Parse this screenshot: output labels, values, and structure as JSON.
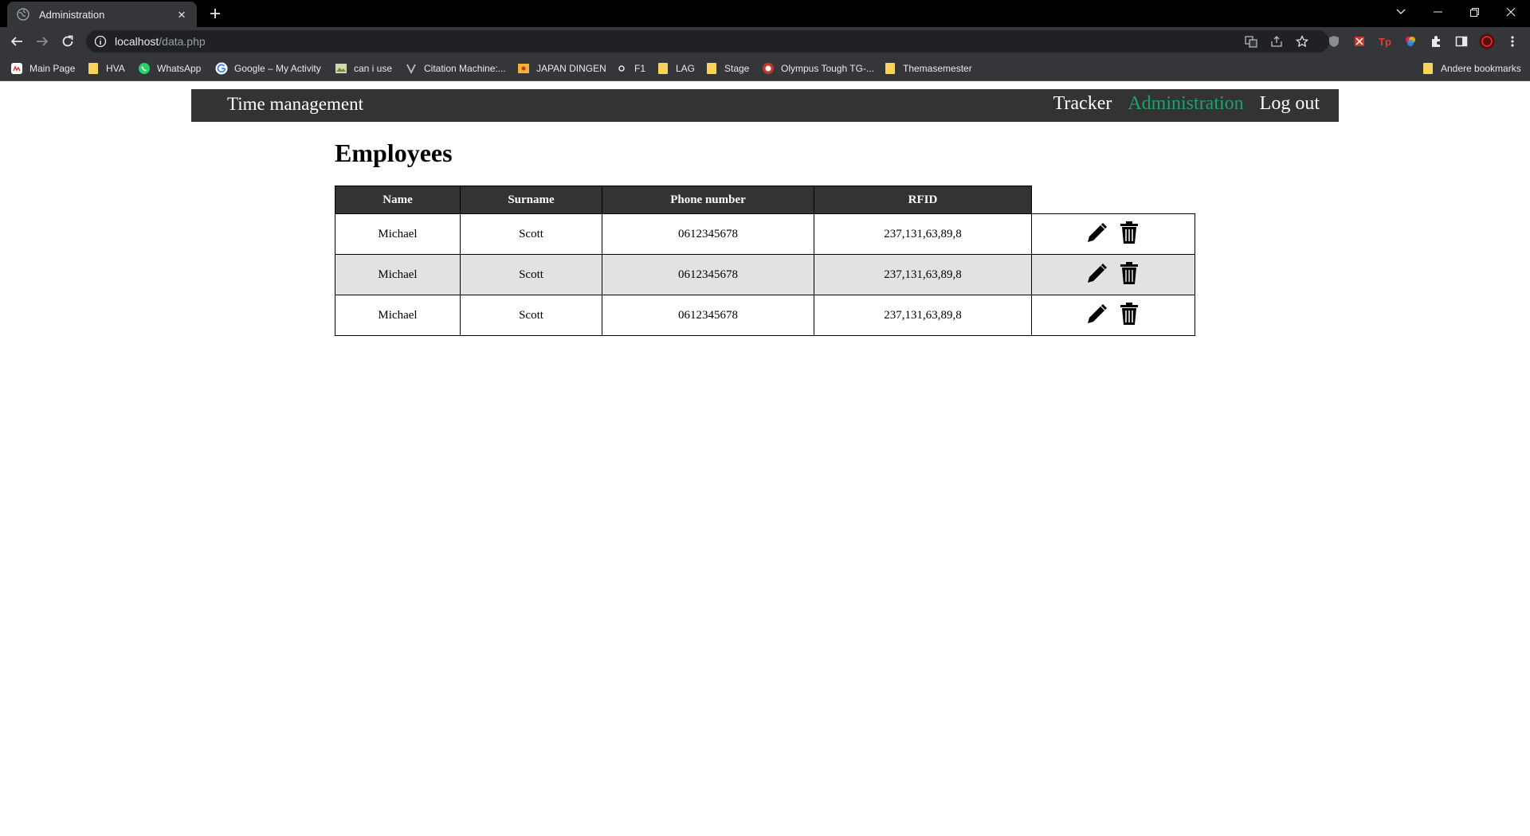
{
  "browser": {
    "tab_title": "Administration",
    "url_host": "localhost",
    "url_path": "/data.php",
    "bookmarks": [
      {
        "label": "Main Page",
        "icon": "app-icon"
      },
      {
        "label": "HVA",
        "icon": "folder-icon"
      },
      {
        "label": "WhatsApp",
        "icon": "whatsapp-icon"
      },
      {
        "label": "Google – My Activity",
        "icon": "google-icon"
      },
      {
        "label": "can i use",
        "icon": "caniuse-icon"
      },
      {
        "label": "Citation Machine:...",
        "icon": "citation-icon"
      },
      {
        "label": "JAPAN DINGEN",
        "icon": "folder-icon"
      },
      {
        "label": "F1",
        "icon": "f1-icon"
      },
      {
        "label": "LAG",
        "icon": "folder-icon"
      },
      {
        "label": "Stage",
        "icon": "folder-icon"
      },
      {
        "label": "Olympus Tough TG-...",
        "icon": "olympus-icon"
      },
      {
        "label": "Themasemester",
        "icon": "folder-icon"
      }
    ],
    "other_bookmarks": "Andere bookmarks"
  },
  "nav": {
    "brand": "Time management",
    "links": [
      {
        "label": "Tracker",
        "active": false
      },
      {
        "label": "Administration",
        "active": true
      },
      {
        "label": "Log out",
        "active": false
      }
    ],
    "active_color": "#1aa36b"
  },
  "page": {
    "title": "Employees"
  },
  "table": {
    "headers": [
      "Name",
      "Surname",
      "Phone number",
      "RFID"
    ],
    "rows": [
      {
        "name": "Michael",
        "surname": "Scott",
        "phone": "0612345678",
        "rfid": "237,131,63,89,8"
      },
      {
        "name": "Michael",
        "surname": "Scott",
        "phone": "0612345678",
        "rfid": "237,131,63,89,8"
      },
      {
        "name": "Michael",
        "surname": "Scott",
        "phone": "0612345678",
        "rfid": "237,131,63,89,8"
      }
    ],
    "row_actions": [
      "pencil-icon",
      "trash-icon"
    ]
  }
}
